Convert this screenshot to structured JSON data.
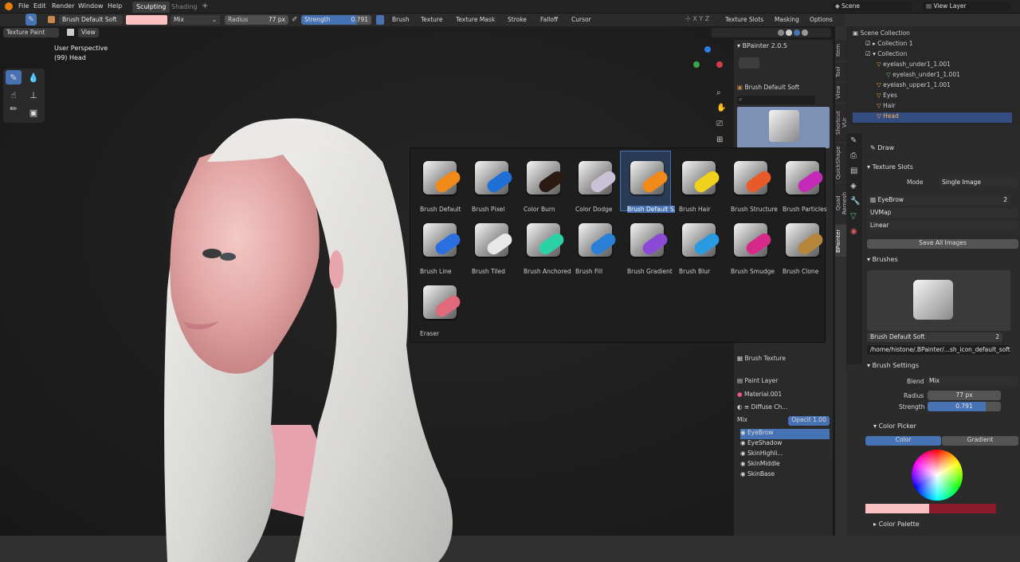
{
  "menus": [
    "File",
    "Edit",
    "Render",
    "Window",
    "Help"
  ],
  "workspaces": [
    "Sculpting",
    "Shading"
  ],
  "topright": {
    "scene": "Scene",
    "view_layer": "View Layer"
  },
  "header": {
    "brush_name": "Brush Default Soft",
    "blend": "Mix",
    "radius_label": "Radius",
    "radius_value": "77 px",
    "strength_label": "Strength",
    "strength_value": "0.791",
    "menus": [
      "Brush",
      "Texture",
      "Texture Mask",
      "Stroke",
      "Falloff",
      "Cursor"
    ],
    "right_items": [
      "Texture Slots",
      "Masking",
      "Options"
    ],
    "mode": "Texture Paint",
    "view": "View"
  },
  "viewport": {
    "overlay_title": "User Perspective",
    "overlay_sub": "(99) Head"
  },
  "bpainter": {
    "title": "BPainter 2.0.5",
    "brush": "Brush Default Soft",
    "brush_texture": "Brush Texture",
    "paint_layer": "Paint Layer",
    "material": "Material.001",
    "diffuse": "Diffuse Ch...",
    "blend": "Mix",
    "opacity": "Opacit 1.00"
  },
  "side_tabs": [
    "Item",
    "Tool",
    "View",
    "Shortcut VUr",
    "QuickShape",
    "Quad Remesh",
    "BPainter"
  ],
  "brushes": [
    {
      "name": "Brush Default",
      "color": "#f28a1a"
    },
    {
      "name": "Brush Pixel",
      "color": "#1e6fd6"
    },
    {
      "name": "Color Burn",
      "color": "#2a1a12"
    },
    {
      "name": "Color Dodge",
      "color": "#c9c2d6"
    },
    {
      "name": "Brush Default S...",
      "color": "#f28a1a"
    },
    {
      "name": "Brush Hair",
      "color": "#f0d21c"
    },
    {
      "name": "Brush Structure",
      "color": "#e85a2a"
    },
    {
      "name": "Brush Particles",
      "color": "#c42ab8"
    },
    {
      "name": "Brush Line",
      "color": "#2a6fe0"
    },
    {
      "name": "Brush Tiled",
      "color": "#e8e8e8"
    },
    {
      "name": "Brush Anchored",
      "color": "#2ad2a6"
    },
    {
      "name": "Brush Fill",
      "color": "#2a7fd6"
    },
    {
      "name": "Brush Gradient",
      "color": "#8a4ad6"
    },
    {
      "name": "Brush Blur",
      "color": "#2a9ae0"
    },
    {
      "name": "Brush Smudge",
      "color": "#d62a8a"
    },
    {
      "name": "Brush Clone",
      "color": "#b8863a"
    },
    {
      "name": "Eraser",
      "color": "#e06a7a"
    }
  ],
  "selected_brush_index": 4,
  "layers": [
    "EyeBrow",
    "EyeShadow",
    "SkinHighli...",
    "SkinMiddle",
    "SkinBase"
  ],
  "outliner": {
    "title": "Scene Collection",
    "items": [
      "Collection 1",
      "Collection",
      "eyelash_under1_1.001",
      "eyelash_under1_1.001",
      "eyelash_upper1_1.001",
      "Eyes",
      "Hair",
      "Head"
    ]
  },
  "properties": {
    "tool": "Draw",
    "texture_slots": "Texture Slots",
    "mode_label": "Mode",
    "mode_value": "Single Image",
    "slot_name": "EyeBrow",
    "slot_users": "2",
    "uv": "UVMap",
    "interp": "Linear",
    "save_all": "Save All Images",
    "brushes": "Brushes",
    "brush_name": "Brush Default Soft",
    "brush_users": "2",
    "brush_path": "/home/histone/.BPainter/...sh_icon_default_soft.png",
    "brush_settings": "Brush Settings",
    "blend_label": "Blend",
    "blend_value": "Mix",
    "radius_label": "Radius",
    "radius_value": "77 px",
    "strength_label": "Strength",
    "strength_value": "0.791",
    "strength_fraction": 0.791,
    "color_picker": "Color Picker",
    "color_tab": "Color",
    "gradient_tab": "Gradient",
    "color_palette": "Color Palette",
    "brush_color": "#fbc1c1"
  }
}
